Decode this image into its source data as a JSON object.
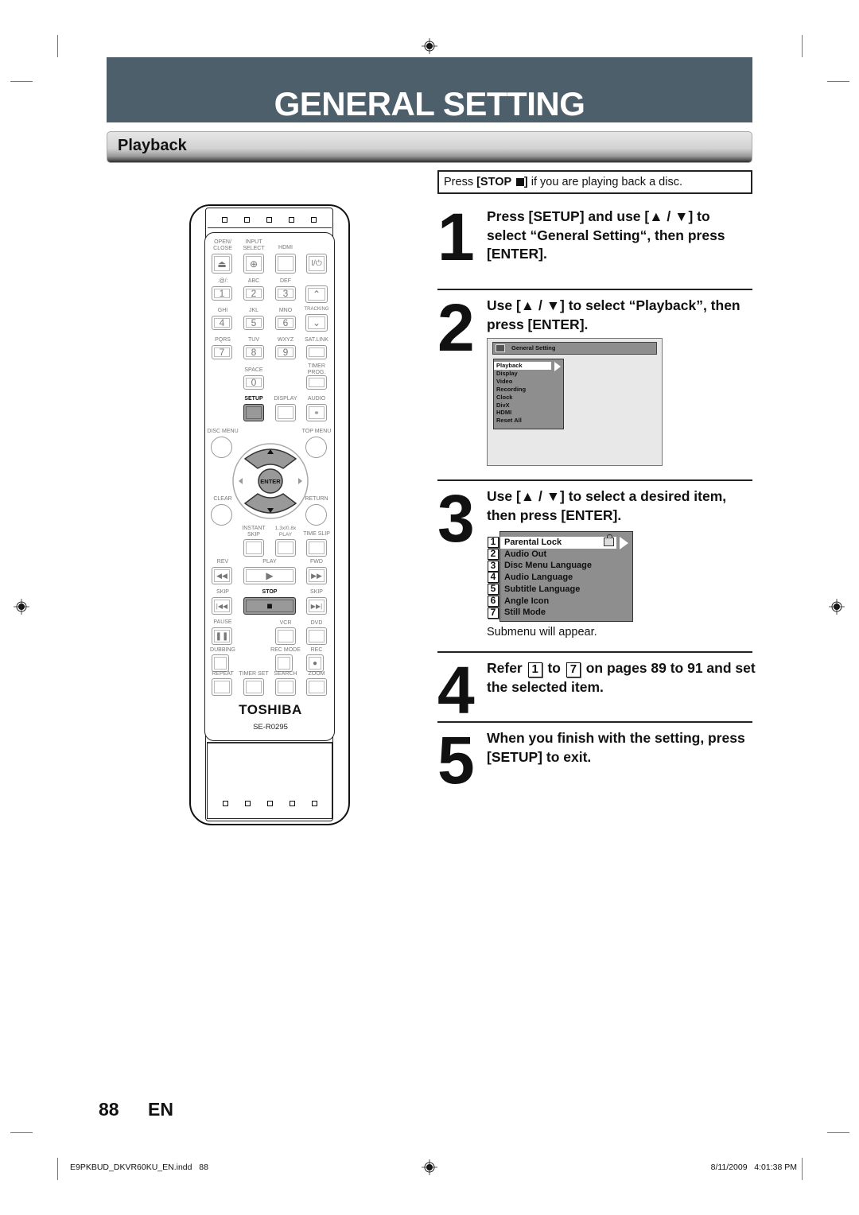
{
  "header": {
    "title": "GENERAL SETTING",
    "section": "Playback",
    "band_color": "#4d5f6b"
  },
  "note": {
    "prefix": "Press ",
    "key": "[STOP ",
    "key_end": "]",
    "suffix": " if you are playing back a disc."
  },
  "steps": [
    {
      "num": "1",
      "text": "Press [SETUP] and use [▲ / ▼] to select “General Setting“, then press [ENTER]."
    },
    {
      "num": "2",
      "text": "Use [▲ / ▼] to select “Playback”, then press [ENTER]."
    },
    {
      "num": "3",
      "text": "Use [▲ / ▼] to select a desired item, then press [ENTER]."
    },
    {
      "num": "4",
      "text_a": "Refer ",
      "box_a": "1",
      "text_b": " to ",
      "box_b": "7",
      "text_c": " on pages 89 to 91 and set the selected item."
    },
    {
      "num": "5",
      "text": "When you finish with the setting, press [SETUP] to exit."
    }
  ],
  "screen_general": {
    "title": "General Setting",
    "items": [
      "Playback",
      "Display",
      "Video",
      "Recording",
      "Clock",
      "DivX",
      "HDMI",
      "Reset All"
    ],
    "selected": "Playback"
  },
  "screen_playback": {
    "numbers": [
      "1",
      "2",
      "3",
      "4",
      "5",
      "6",
      "7"
    ],
    "items": [
      "Parental Lock",
      "Audio Out",
      "Disc Menu Language",
      "Audio Language",
      "Subtitle Language",
      "Angle Icon",
      "Still Mode"
    ],
    "selected": "Parental Lock",
    "caption": "Submenu will appear."
  },
  "remote": {
    "brand": "TOSHIBA",
    "model": "SE-R0295",
    "labels": {
      "open_close": "OPEN/\nCLOSE",
      "input_select": "INPUT\nSELECT",
      "hdmi": "HDMI",
      "k1": ".@/:",
      "k2": "ABC",
      "k3": "DEF",
      "k4": "GHI",
      "k5": "JKL",
      "k6": "MNO",
      "k7": "PQRS",
      "k8": "TUV",
      "k9": "WXYZ",
      "tracking": "TRACKING",
      "sat_link": "SAT.LINK",
      "space": "SPACE",
      "timer_prog": "TIMER\nPROG.",
      "setup": "SETUP",
      "display": "DISPLAY",
      "audio": "AUDIO",
      "disc_menu": "DISC MENU",
      "top_menu": "TOP MENU",
      "enter": "ENTER",
      "clear": "CLEAR",
      "return": "RETURN",
      "instant_skip": "INSTANT\nSKIP",
      "speed_play": "1.3x/0.8x\nPLAY",
      "time_slip": "TIME SLIP",
      "rev": "REV",
      "play": "PLAY",
      "fwd": "FWD",
      "skip_l": "SKIP",
      "stop": "STOP",
      "skip_r": "SKIP",
      "pause": "PAUSE",
      "vcr": "VCR",
      "dvd": "DVD",
      "dubbing": "DUBBING",
      "rec_mode": "REC MODE",
      "rec": "REC",
      "repeat": "REPEAT",
      "timer_set": "TIMER SET",
      "search": "SEARCH",
      "zoom": "ZOOM"
    },
    "digits": [
      "1",
      "2",
      "3",
      "4",
      "5",
      "6",
      "7",
      "8",
      "9",
      "0"
    ],
    "power_glyph": "I/⏻"
  },
  "footer": {
    "page_number": "88",
    "language": "EN",
    "slug_file": "E9PKBUD_DKVR60KU_EN.indd   88",
    "slug_date": "8/11/2009   4:01:38 PM"
  }
}
